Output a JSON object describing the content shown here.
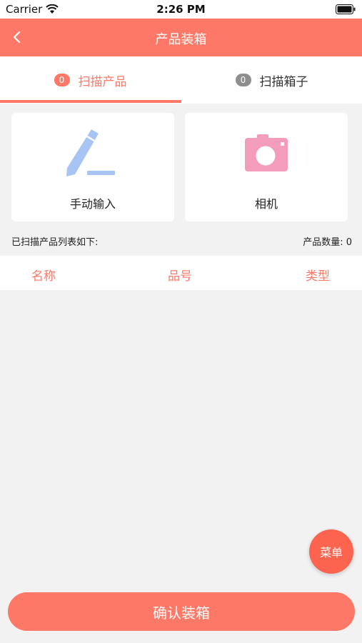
{
  "status_bar": {
    "carrier": "Carrier",
    "time": "2:26 PM",
    "wifi_icon": "wifi-icon",
    "battery_icon": "battery-icon"
  },
  "nav": {
    "title": "产品装箱",
    "back_icon": "chevron-left-icon",
    "background": "#fd7866"
  },
  "tabs": [
    {
      "badge": "0",
      "label": "扫描产品",
      "active": true
    },
    {
      "badge": "0",
      "label": "扫描箱子",
      "active": false
    }
  ],
  "cards": {
    "manual": {
      "label": "手动输入",
      "icon": "pencil-icon",
      "icon_color": "#a8c4f5"
    },
    "camera": {
      "label": "相机",
      "icon": "camera-icon",
      "icon_color": "#f39cbc"
    }
  },
  "list": {
    "caption": "已扫描产品列表如下:",
    "count_label": "产品数量: 0",
    "columns": [
      "名称",
      "品号",
      "类型"
    ]
  },
  "fab": {
    "label": "菜单"
  },
  "confirm": {
    "label": "确认装箱"
  },
  "colors": {
    "accent": "#fd7866",
    "fab": "#fd6450",
    "background": "#f2f2f2"
  }
}
